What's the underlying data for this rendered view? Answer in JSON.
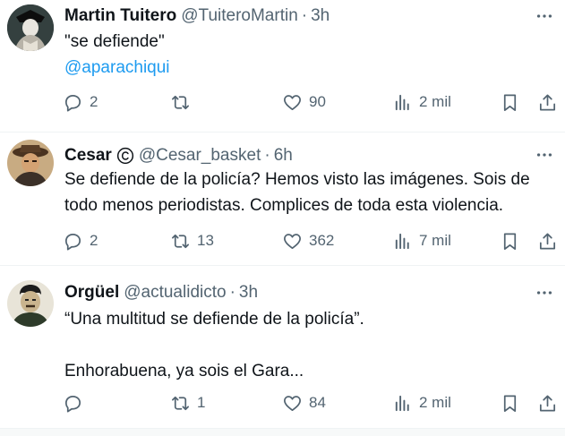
{
  "tweets": [
    {
      "name": "Martin Tuitero",
      "handle": "@TuiteroMartin",
      "separator": "·",
      "time": "3h",
      "line1": "\"se defiende\"",
      "line2": "@aparachiqui",
      "replies": "2",
      "retweets": "",
      "likes": "90",
      "views": "2 mil"
    },
    {
      "name": "Cesar",
      "handle": "@Cesar_basket",
      "separator": "·",
      "time": "6h",
      "line1": "Se defiende de la policía? Hemos visto las imágenes. Sois de",
      "line2": "todo menos periodistas. Complices de toda esta violencia.",
      "replies": "2",
      "retweets": "13",
      "likes": "362",
      "views": "7 mil"
    },
    {
      "name": "Orgüel",
      "handle": "@actualidicto",
      "separator": "·",
      "time": "3h",
      "line1": "“Una multitud se defiende de la policía”.",
      "line2": "Enhorabuena, ya sois el Gara...",
      "replies": "",
      "retweets": "1",
      "likes": "84",
      "views": "2 mil"
    }
  ],
  "icons": {
    "more": "more-icon",
    "reply": "reply-icon",
    "retweet": "retweet-icon",
    "like": "heart-icon",
    "views": "views-icon",
    "bookmark": "bookmark-icon",
    "share": "share-icon",
    "verified": "copyright-badge-icon"
  },
  "colors": {
    "text": "#0f1419",
    "secondary": "#536471",
    "link": "#1d9bf0",
    "divider": "#eff3f4"
  }
}
